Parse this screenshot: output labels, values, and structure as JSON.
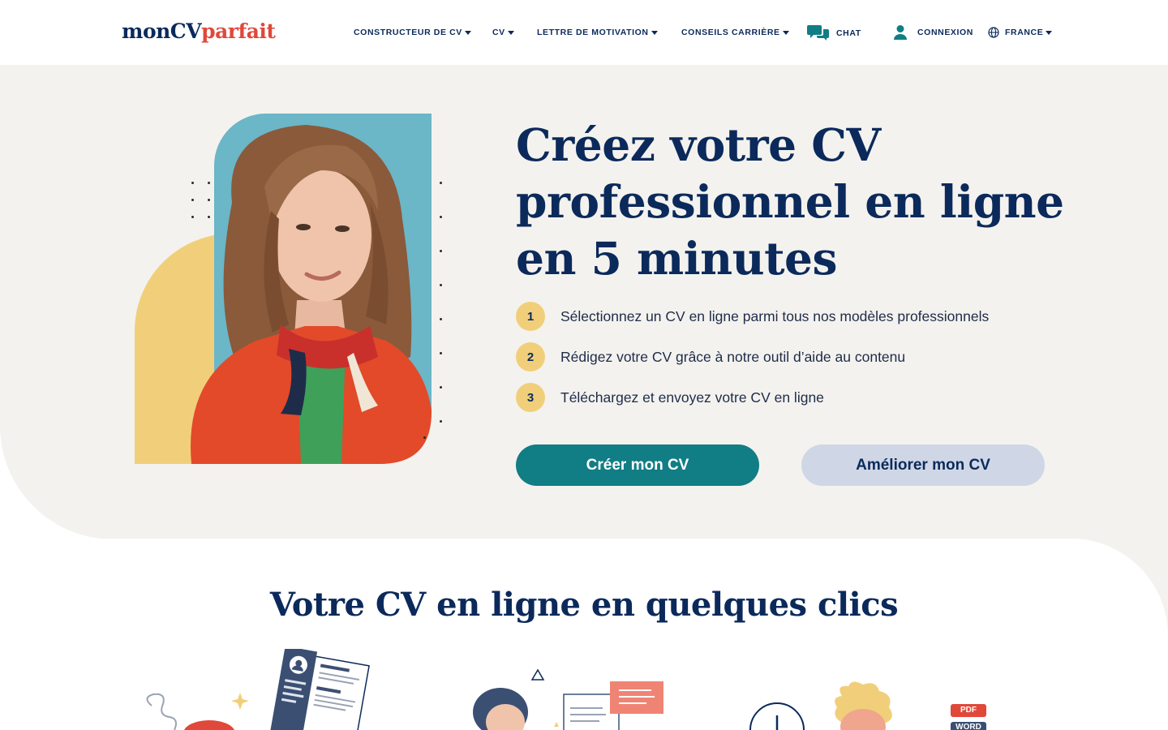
{
  "header": {
    "logo_part1": "monCV",
    "logo_part2": "parfait",
    "nav": {
      "constructeur": "CONSTRUCTEUR DE CV",
      "cv": "CV",
      "lettre": "LETTRE DE MOTIVATION",
      "conseils": "CONSEILS CARRIÈRE",
      "chat": "CHAT",
      "connexion": "CONNEXION",
      "france": "FRANCE"
    }
  },
  "hero": {
    "title_line1": "Créez votre CV",
    "title_line2": "professionnel en ligne",
    "title_line3": "en 5 minutes",
    "steps": [
      {
        "num": "1",
        "text": "Sélectionnez un CV en ligne parmi tous nos modèles professionnels"
      },
      {
        "num": "2",
        "text": "Rédigez votre CV grâce à notre outil d’aide au contenu"
      },
      {
        "num": "3",
        "text": "Téléchargez et envoyez votre CV en ligne"
      }
    ],
    "btn_primary": "Créer mon CV",
    "btn_secondary": "Améliorer mon CV"
  },
  "section2": {
    "title": "Votre CV en ligne en quelques clics",
    "badge_pdf": "PDF",
    "badge_word": "WORD"
  },
  "colors": {
    "navy": "#0b2a5b",
    "red": "#e0483a",
    "teal": "#117d85",
    "yellow": "#f1cf7a",
    "blue_card": "#6bb6c7",
    "hero_bg": "#f4f2ee",
    "btn_secondary_bg": "#cfd7e6"
  }
}
